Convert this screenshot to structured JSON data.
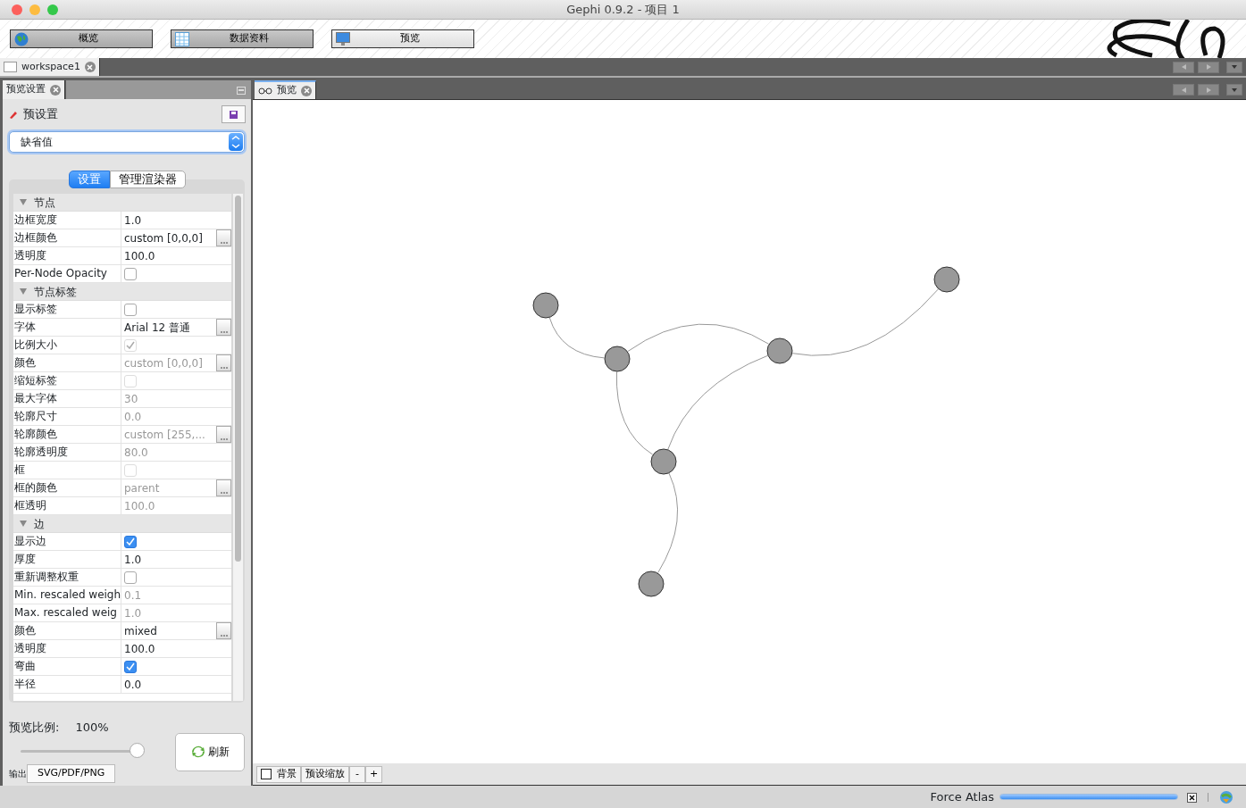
{
  "window": {
    "title": "Gephi 0.9.2 - 项目 1"
  },
  "toolbar": [
    {
      "label": "概览",
      "selected": false
    },
    {
      "label": "数据资料",
      "selected": false
    },
    {
      "label": "预览",
      "selected": true
    }
  ],
  "workspace_tabs": [
    {
      "label": "workspace1",
      "selected": true
    }
  ],
  "settings_panel": {
    "tab": "预览设置",
    "title": "预设置",
    "preset": "缺省值",
    "tabs": [
      {
        "label": "设置",
        "selected": true
      },
      {
        "label": "管理渲染器",
        "selected": false
      }
    ],
    "sections": [
      {
        "title": "节点",
        "expanded": true,
        "rows": [
          {
            "label": "边框宽度",
            "kind": "text",
            "value": "1.0",
            "disabled": false
          },
          {
            "label": "边框颜色",
            "kind": "color",
            "value": "custom [0,0,0]",
            "disabled": false
          },
          {
            "label": "透明度",
            "kind": "text",
            "value": "100.0",
            "disabled": false
          },
          {
            "label": "Per-Node Opacity",
            "kind": "checkbox",
            "checked": false,
            "disabled": false
          }
        ]
      },
      {
        "title": "节点标签",
        "expanded": true,
        "rows": [
          {
            "label": "显示标签",
            "kind": "checkbox",
            "checked": false,
            "disabled": false
          },
          {
            "label": "字体",
            "kind": "color",
            "value": "Arial 12 普通",
            "disabled": false
          },
          {
            "label": "比例大小",
            "kind": "checkbox",
            "checked": true,
            "disabled": true
          },
          {
            "label": "颜色",
            "kind": "color",
            "value": "custom [0,0,0]",
            "disabled": true
          },
          {
            "label": "缩短标签",
            "kind": "checkbox",
            "checked": false,
            "disabled": true
          },
          {
            "label": "最大字体",
            "kind": "text",
            "value": "30",
            "disabled": true
          },
          {
            "label": "轮廓尺寸",
            "kind": "text",
            "value": "0.0",
            "disabled": true
          },
          {
            "label": "轮廓颜色",
            "kind": "color",
            "value": "custom [255,...",
            "disabled": true
          },
          {
            "label": "轮廓透明度",
            "kind": "text",
            "value": "80.0",
            "disabled": true
          },
          {
            "label": "框",
            "kind": "checkbox",
            "checked": false,
            "disabled": true
          },
          {
            "label": "框的颜色",
            "kind": "color",
            "value": "parent",
            "disabled": true
          },
          {
            "label": "框透明",
            "kind": "text",
            "value": "100.0",
            "disabled": true
          }
        ]
      },
      {
        "title": "边",
        "expanded": true,
        "rows": [
          {
            "label": "显示边",
            "kind": "checkbox",
            "checked": true,
            "disabled": false
          },
          {
            "label": "厚度",
            "kind": "text",
            "value": "1.0",
            "disabled": false
          },
          {
            "label": "重新调整权重",
            "kind": "checkbox",
            "checked": false,
            "disabled": false
          },
          {
            "label": "Min. rescaled weigh",
            "kind": "text",
            "value": "0.1",
            "disabled": true
          },
          {
            "label": "Max. rescaled weig",
            "kind": "text",
            "value": "1.0",
            "disabled": true
          },
          {
            "label": "颜色",
            "kind": "color",
            "value": "mixed",
            "disabled": false
          },
          {
            "label": "透明度",
            "kind": "text",
            "value": "100.0",
            "disabled": false
          },
          {
            "label": "弯曲",
            "kind": "checkbox",
            "checked": true,
            "disabled": false
          },
          {
            "label": "半径",
            "kind": "text",
            "value": "0.0",
            "disabled": false
          }
        ]
      }
    ],
    "ratio_label": "预览比例:",
    "ratio_value": "100%",
    "ratio_slider": {
      "level": 1.0
    },
    "refresh": "刷新",
    "export_label": "输出",
    "export_button": "SVG/PDF/PNG"
  },
  "preview_panel": {
    "tab": "预览",
    "background": {
      "label": "背景",
      "checked": false
    },
    "zoom_buttons": [
      "预设缩放",
      "-",
      "+"
    ]
  },
  "status_bar": {
    "task": "Force Atlas",
    "progress": {
      "level": 1.0
    }
  }
}
